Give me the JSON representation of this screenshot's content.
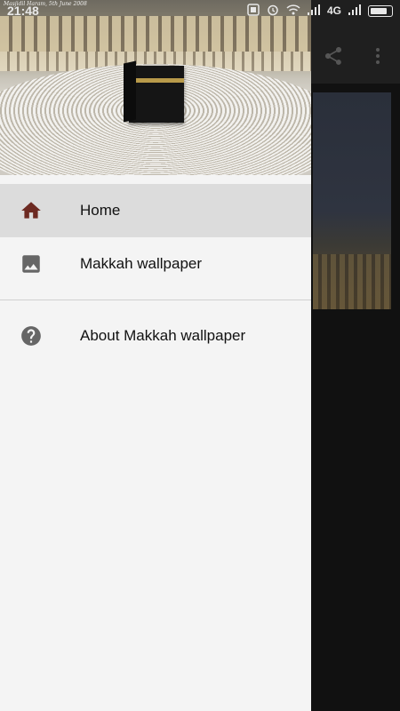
{
  "status_bar": {
    "time": "21:48",
    "network": "4G",
    "icons": [
      "notification-icon",
      "alarm-icon",
      "wifi-icon",
      "signal-icon",
      "battery-icon"
    ]
  },
  "header_image": {
    "caption": "Masjidil Haram, 5th June 2008"
  },
  "toolbar": {
    "actions": [
      "share-icon",
      "more-vert-icon"
    ]
  },
  "drawer": {
    "items": [
      {
        "label": "Home",
        "icon": "home-icon",
        "selected": true
      },
      {
        "label": "Makkah wallpaper",
        "icon": "image-icon",
        "selected": false
      },
      {
        "label": "About Makkah wallpaper",
        "icon": "help-icon",
        "selected": false
      }
    ]
  },
  "colors": {
    "selected_icon": "#6d2a22",
    "icon_default": "#666666",
    "drawer_bg": "#f4f4f4",
    "selected_bg": "#dcdcdc"
  }
}
